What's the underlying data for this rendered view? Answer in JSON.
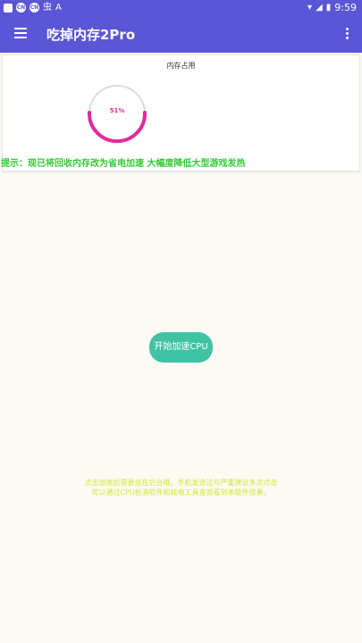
{
  "status_bar": {
    "left_icons": [
      "square-icon",
      "cn-icon",
      "cn-icon",
      "bug-icon",
      "a-icon"
    ],
    "badges": [
      "CN",
      "CN"
    ],
    "bug_glyph": "虫",
    "a_glyph": "A",
    "wifi_glyph": "▾",
    "signal_glyph": "◢",
    "battery_glyph": "▮",
    "time": "9:59"
  },
  "app_bar": {
    "title": "吃掉内存2Pro",
    "color": "#5a56d6"
  },
  "memory_card": {
    "title": "内存占用",
    "usage_percent": 51,
    "usage_label": "51%",
    "gauge_color": "#e02a9e",
    "track_color": "#dcdcdc",
    "tip": "提示：现已将回收内存改为省电加速 大幅度降低大型游戏发热"
  },
  "start_button": {
    "label": "开始加速CPU",
    "color": "#3fc3a4"
  },
  "note": {
    "line1": "点击加速后需要挂在后台哦，手机发烫过与严重建议多次点击",
    "line2": "可以通过CPU检测软件和耗电工具查观看到本软件效果。"
  }
}
